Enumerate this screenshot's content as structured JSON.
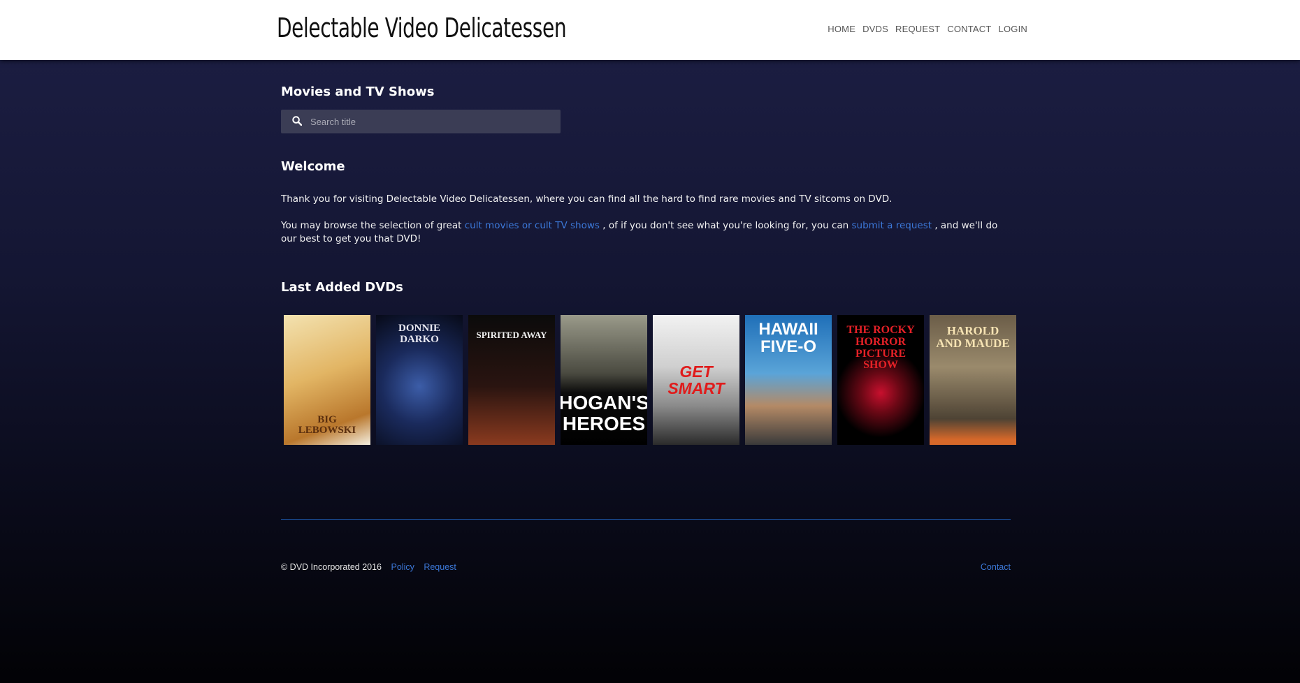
{
  "header": {
    "brand": "Delectable Video Delicatessen",
    "nav": [
      "HOME",
      "DVDS",
      "REQUEST",
      "CONTACT",
      "LOGIN"
    ]
  },
  "search_section": {
    "title": "Movies and TV Shows",
    "placeholder": "Search title"
  },
  "welcome": {
    "title": "Welcome",
    "para1": "Thank you for visiting Delectable Video Delicatessen, where you can find all the hard to find rare movies and TV sitcoms on DVD.",
    "para2_a": "You may browse the selection of great ",
    "link_browse": "cult movies or cult TV shows",
    "para2_b": " , of if you don't see what you're looking for, you can ",
    "link_request": "submit a request",
    "para2_c": " , and we'll do our best to get you that DVD!"
  },
  "last_added": {
    "title": "Last Added DVDs",
    "dvds": [
      {
        "title": "BIG LEBOWSKI"
      },
      {
        "title": "DONNIE DARKO"
      },
      {
        "title": "SPIRITED AWAY"
      },
      {
        "title": "HOGAN'S HEROES"
      },
      {
        "title": "GET SMART"
      },
      {
        "title": "HAWAII FIVE-O"
      },
      {
        "title": "THE ROCKY HORROR PICTURE SHOW"
      },
      {
        "title": "HAROLD AND MAUDE"
      }
    ]
  },
  "footer": {
    "copyright": "© DVD Incorporated 2016",
    "links": [
      "Policy",
      "Request"
    ],
    "contact": "Contact"
  },
  "colors": {
    "link": "#3c78d8",
    "divider": "#1e5bb0",
    "search_bg": "#3b3d55"
  }
}
